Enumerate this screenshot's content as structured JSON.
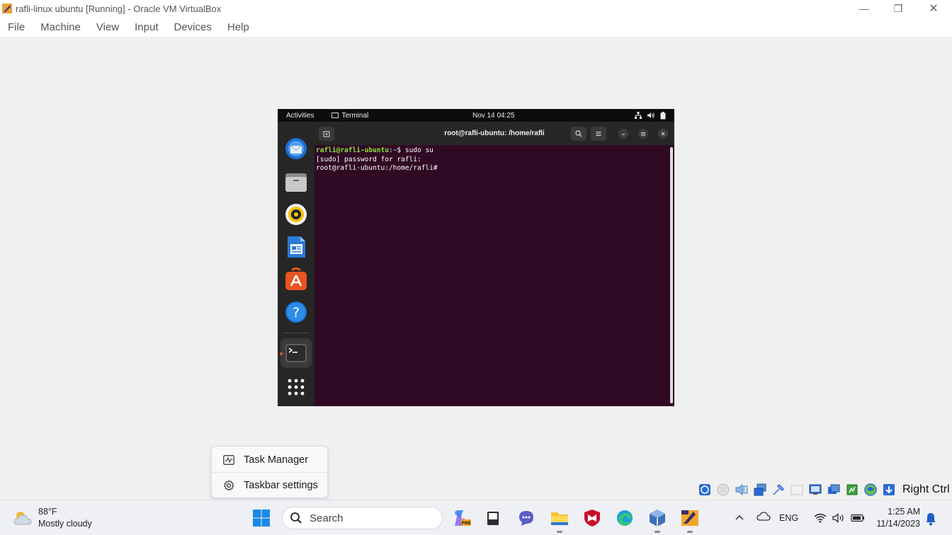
{
  "window": {
    "title": "rafli-linux ubuntu [Running] - Oracle VM VirtualBox",
    "controls": {
      "minimize": "—",
      "restore": "❐",
      "close": "✕"
    }
  },
  "menubar": [
    "File",
    "Machine",
    "View",
    "Input",
    "Devices",
    "Help"
  ],
  "guest": {
    "topbar": {
      "activities": "Activities",
      "app": "Terminal",
      "clock": "Nov 14  04:25"
    },
    "dock": [
      "thunderbird-icon",
      "files-icon",
      "rhythmbox-icon",
      "libreoffice-writer-icon",
      "app-center-icon",
      "help-icon",
      "terminal-icon",
      "show-apps-icon"
    ],
    "terminal": {
      "title": "root@rafli-ubuntu: /home/rafli",
      "lines": {
        "l1_user": "rafli@rafli-ubuntu",
        "l1_sep": ":",
        "l1_path": "~",
        "l1_cmd": "$ sudo su",
        "l2": "[sudo] password for rafli:",
        "l3": "root@rafli-ubuntu:/home/rafli#"
      }
    }
  },
  "context_menu": {
    "items": [
      {
        "label": "Task Manager",
        "icon": "task-manager-icon"
      },
      {
        "label": "Taskbar settings",
        "icon": "gear-icon"
      }
    ]
  },
  "vbox_status": {
    "host_key": "Right Ctrl"
  },
  "taskbar": {
    "weather": {
      "temp": "88°F",
      "desc": "Mostly cloudy"
    },
    "search_label": "Search",
    "tray": {
      "lang": "ENG",
      "time": "1:25 AM",
      "date": "11/14/2023"
    }
  }
}
